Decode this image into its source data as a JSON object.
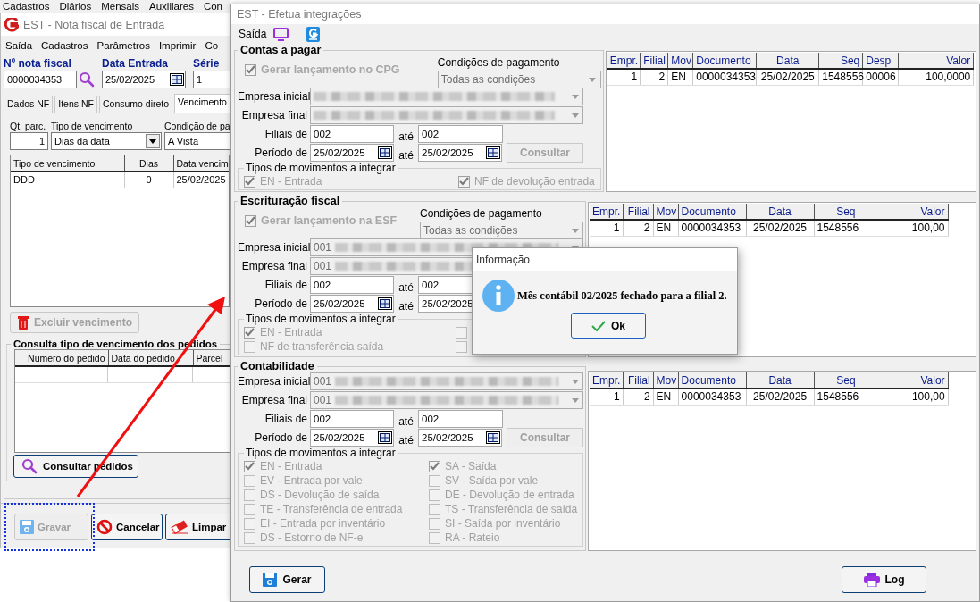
{
  "app_menu": [
    "Cadastros",
    "Diários",
    "Mensais",
    "Auxiliares",
    "Con"
  ],
  "nf_window": {
    "title": "EST - Nota fiscal de Entrada",
    "menu": [
      "Saída",
      "Cadastros",
      "Parâmetros",
      "Imprimir",
      "Co"
    ],
    "fields": [
      {
        "label": "Nº nota fiscal",
        "value": "0000034353",
        "kind": "search"
      },
      {
        "label": "Data Entrada",
        "value": "25/02/2025",
        "kind": "date"
      },
      {
        "label": "Série",
        "value": "1",
        "kind": "text"
      }
    ],
    "tabs": [
      {
        "label": "Dados NF",
        "selected": false
      },
      {
        "label": "Itens NF",
        "selected": false
      },
      {
        "label": "Consumo direto",
        "selected": false
      },
      {
        "label": "Vencimento",
        "selected": true
      }
    ],
    "qt_parc": {
      "label": "Qt. parc.",
      "value": "1"
    },
    "tipo_vencimento": {
      "label": "Tipo de vencimento",
      "value": "Dias da data"
    },
    "condicao": {
      "label": "Condição de pa",
      "value": "A Vista"
    },
    "vencimentos": {
      "columns": [
        {
          "label": "Tipo de vencimento",
          "kind": "text"
        },
        {
          "label": "Dias",
          "kind": "center"
        },
        {
          "label": "Data vencim",
          "kind": "text"
        }
      ],
      "rows": [
        [
          "DDD",
          "0",
          "25/02/2025"
        ]
      ]
    },
    "excluir_button": {
      "label": "Excluir vencimento",
      "disabled": true
    },
    "pedidos": {
      "title": "Consulta tipo de vencimento dos pedidos",
      "columns": [
        {
          "label": "Numero do pedido",
          "kind": "number"
        },
        {
          "label": "Data do pedido",
          "kind": "text"
        },
        {
          "label": "Parcel",
          "kind": "text"
        }
      ],
      "button": "Consultar pedidos"
    },
    "buttons": [
      {
        "label": "Gravar",
        "kind": "save",
        "disabled": true
      },
      {
        "label": "Cancelar",
        "kind": "cancel",
        "disabled": false
      },
      {
        "label": "Limpar",
        "kind": "clear",
        "disabled": false
      }
    ]
  },
  "integ_window": {
    "title": "EST - Efetua integrações",
    "toolbar": "Saída",
    "sections": [
      {
        "title": "Contas a pagar",
        "generate": {
          "label": "Gerar lançamento no CPG",
          "checked": true
        },
        "condicoes": {
          "label": "Condições de pagamento",
          "value": "Todas as condições"
        },
        "empresa_inicial": {
          "label": "Empresa inicial"
        },
        "empresa_final": {
          "label": "Empresa final"
        },
        "filiais": {
          "label": "Filiais de",
          "from": "002",
          "to_label": "até",
          "to": "002"
        },
        "periodo": {
          "label": "Período de",
          "from": "25/02/2025",
          "to_label": "até",
          "to": "25/02/2025"
        },
        "consultar": {
          "label": "Consultar",
          "disabled": true
        },
        "movimentos": {
          "title": "Tipos de movimentos a integrar",
          "columns": [
            [
              {
                "label": "EN - Entrada",
                "checked": true
              }
            ],
            [
              {
                "label": "NF de devolução entrada",
                "checked": true
              }
            ]
          ]
        },
        "grid": {
          "columns": [
            {
              "label": "Empr.",
              "kind": "number"
            },
            {
              "label": "Filial",
              "kind": "number"
            },
            {
              "label": "Mov",
              "kind": "text"
            },
            {
              "label": "Documento",
              "kind": "text"
            },
            {
              "label": "Data",
              "kind": "center"
            },
            {
              "label": "Seq",
              "kind": "number"
            },
            {
              "label": "Desp",
              "kind": "text"
            },
            {
              "label": "Valor",
              "kind": "number"
            }
          ],
          "rows": [
            [
              "1",
              "2",
              "EN",
              "0000034353",
              "25/02/2025",
              "1548556",
              "00006",
              "100,0000"
            ]
          ]
        }
      },
      {
        "title": "Escrituração fiscal",
        "generate": {
          "label": "Gerar lançamento na ESF",
          "checked": true
        },
        "condicoes": {
          "label": "Condições de pagamento",
          "value": "Todas as condições"
        },
        "empresa_inicial": {
          "label": "Empresa inicial",
          "value": "001"
        },
        "empresa_final": {
          "label": "Empresa final",
          "value": "001"
        },
        "filiais": {
          "label": "Filiais de",
          "from": "002",
          "to_label": "até",
          "to": "002"
        },
        "periodo": {
          "label": "Período de",
          "from": "25/02/2025",
          "to_label": "até",
          "to": "25/02/2025"
        },
        "movimentos": {
          "title": "Tipos de movimentos a integrar",
          "columns": [
            [
              {
                "label": "EN - Entrada",
                "checked": true
              },
              {
                "label": "NF de transferência saída",
                "checked": false
              }
            ],
            [
              {
                "checked": false
              },
              {
                "checked": false
              }
            ]
          ]
        },
        "grid": {
          "columns": [
            {
              "label": "Empr.",
              "kind": "number"
            },
            {
              "label": "Filial",
              "kind": "number"
            },
            {
              "label": "Mov",
              "kind": "text"
            },
            {
              "label": "Documento",
              "kind": "text"
            },
            {
              "label": "Data",
              "kind": "center"
            },
            {
              "label": "Seq",
              "kind": "number"
            },
            {
              "label": "Valor",
              "kind": "number"
            }
          ],
          "rows": [
            [
              "1",
              "2",
              "EN",
              "0000034353",
              "25/02/2025",
              "1548556",
              "100,00"
            ]
          ]
        }
      },
      {
        "title": "Contabilidade",
        "empresa_inicial": {
          "label": "Empresa inicial",
          "value": "001"
        },
        "empresa_final": {
          "label": "Empresa final",
          "value": "001"
        },
        "filiais": {
          "label": "Filiais de",
          "from": "002",
          "to_label": "até",
          "to": "002"
        },
        "periodo": {
          "label": "Período de",
          "from": "25/02/2025",
          "to_label": "até",
          "to": "25/02/2025"
        },
        "consultar": {
          "label": "Consultar",
          "disabled": true
        },
        "movimentos": {
          "title": "Tipos de movimentos a integrar",
          "columns": [
            [
              {
                "label": "EN - Entrada",
                "checked": true
              },
              {
                "label": "EV - Entrada por vale",
                "checked": false
              },
              {
                "label": "DS - Devolução de saída",
                "checked": false
              },
              {
                "label": "TE - Transferência de entrada",
                "checked": false
              },
              {
                "label": "EI - Entrada por inventário",
                "checked": false
              },
              {
                "label": "DS - Estorno de NF-e",
                "checked": false
              }
            ],
            [
              {
                "label": "SA - Saída",
                "checked": true
              },
              {
                "label": "SV - Saída por vale",
                "checked": false
              },
              {
                "label": "DE - Devolução de entrada",
                "checked": false
              },
              {
                "label": "TS - Transferência de saída",
                "checked": false
              },
              {
                "label": "SI - Saída por inventário",
                "checked": false
              },
              {
                "label": "RA - Rateio",
                "checked": false
              }
            ]
          ]
        },
        "grid": {
          "columns": [
            {
              "label": "Empr.",
              "kind": "number"
            },
            {
              "label": "Filial",
              "kind": "number"
            },
            {
              "label": "Mov",
              "kind": "text"
            },
            {
              "label": "Documento",
              "kind": "text"
            },
            {
              "label": "Data",
              "kind": "center"
            },
            {
              "label": "Seq",
              "kind": "number"
            },
            {
              "label": "Valor",
              "kind": "number"
            }
          ],
          "rows": [
            [
              "1",
              "2",
              "EN",
              "0000034353",
              "25/02/2025",
              "1548556",
              "100,00"
            ]
          ]
        }
      }
    ],
    "buttons": [
      {
        "label": "Gerar",
        "kind": "save"
      },
      {
        "label": "Log",
        "kind": "print"
      }
    ]
  },
  "dialog": {
    "title": "Informação",
    "message": "Mês contábil 02/2025 fechado para a filial 2.",
    "button": "Ok"
  }
}
